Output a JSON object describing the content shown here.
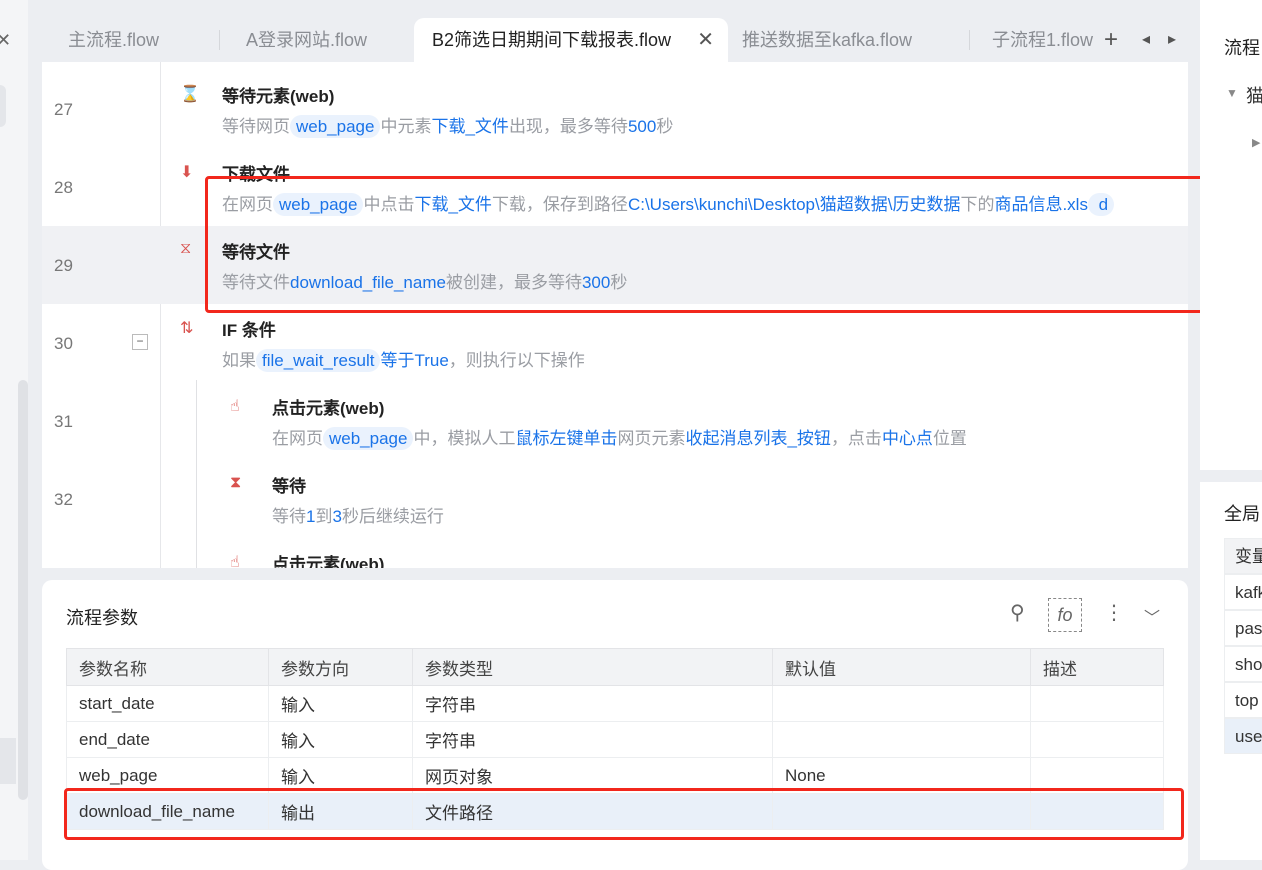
{
  "tabs": [
    {
      "label": "主流程.flow"
    },
    {
      "label": "A登录网站.flow"
    },
    {
      "label": "B2筛选日期期间下载报表.flow",
      "active": true
    },
    {
      "label": "推送数据至kafka.flow"
    },
    {
      "label": "子流程1.flow"
    }
  ],
  "tab_controls": {
    "add": "+",
    "prev": "◂",
    "next": "▸",
    "close": "✕"
  },
  "steps": [
    {
      "num": "27",
      "icon": "wait-element-icon",
      "title": "等待元素(web)",
      "desc": [
        {
          "t": "等待网页"
        },
        {
          "t": "web_page",
          "k": "chip"
        },
        {
          "t": "中元素"
        },
        {
          "t": "下载_文件",
          "k": "lk"
        },
        {
          "t": "出现，最多等待"
        },
        {
          "t": "500",
          "k": "lk"
        },
        {
          "t": "秒"
        }
      ]
    },
    {
      "num": "28",
      "icon": "download-file-icon",
      "title": "下载文件",
      "desc": [
        {
          "t": "在网页"
        },
        {
          "t": "web_page",
          "k": "chip"
        },
        {
          "t": "中点击"
        },
        {
          "t": "下载_文件",
          "k": "lk"
        },
        {
          "t": "下载，保存到路径"
        },
        {
          "t": "C:\\Users\\kunchi\\Desktop\\猫超数据\\历史数据",
          "k": "lk"
        },
        {
          "t": "下的"
        },
        {
          "t": "商品信息.xls",
          "k": "lk"
        },
        {
          "t": " d",
          "k": "chip"
        }
      ]
    },
    {
      "num": "29",
      "icon": "wait-file-icon",
      "title": "等待文件",
      "desc": [
        {
          "t": "等待文件"
        },
        {
          "t": "download_file_name",
          "k": "lk"
        },
        {
          "t": "被创建，最多等待"
        },
        {
          "t": "300",
          "k": "lk"
        },
        {
          "t": "秒"
        }
      ],
      "highlighted": true
    },
    {
      "num": "30",
      "icon": "if-condition-icon",
      "title": "IF 条件",
      "desc": [
        {
          "t": "如果"
        },
        {
          "t": "file_wait_result",
          "k": "chip"
        },
        {
          "t": "等于True",
          "k": "lk"
        },
        {
          "t": "，则执行以下操作"
        }
      ],
      "collapse": "−"
    },
    {
      "num": "31",
      "icon": "click-element-icon",
      "title": "点击元素(web)",
      "desc": [
        {
          "t": "在网页"
        },
        {
          "t": "web_page",
          "k": "chip"
        },
        {
          "t": "中，模拟人工"
        },
        {
          "t": "鼠标左键单击",
          "k": "lk"
        },
        {
          "t": "网页元素"
        },
        {
          "t": "收起消息列表_按钮",
          "k": "lk"
        },
        {
          "t": "，点击"
        },
        {
          "t": "中心点",
          "k": "lk"
        },
        {
          "t": "位置"
        }
      ],
      "indent": true
    },
    {
      "num": "32",
      "icon": "hourglass-icon",
      "title": "等待",
      "desc": [
        {
          "t": "等待"
        },
        {
          "t": "1",
          "k": "lk"
        },
        {
          "t": "到"
        },
        {
          "t": "3",
          "k": "lk"
        },
        {
          "t": "秒后继续运行"
        }
      ],
      "indent": true
    },
    {
      "num": "",
      "icon": "click-element-icon",
      "title": "点击元素(web)",
      "desc": [],
      "indent": true
    }
  ],
  "params": {
    "title": "流程参数",
    "fx_label": "fo",
    "columns": [
      "参数名称",
      "参数方向",
      "参数类型",
      "默认值",
      "描述"
    ],
    "rows": [
      [
        "start_date",
        "输入",
        "字符串",
        "",
        ""
      ],
      [
        "end_date",
        "输入",
        "字符串",
        "",
        ""
      ],
      [
        "web_page",
        "输入",
        "网页对象",
        "None",
        ""
      ],
      [
        "download_file_name",
        "输出",
        "文件路径",
        "",
        ""
      ]
    ]
  },
  "right": {
    "title": "流程",
    "tree_item": "猫",
    "global_title": "全局",
    "global_col": "变量",
    "globals": [
      "kafka",
      "pas",
      "sho",
      "top",
      "use"
    ]
  },
  "colors": {
    "accent": "#1a73e8",
    "highlight": "#f2271c"
  }
}
